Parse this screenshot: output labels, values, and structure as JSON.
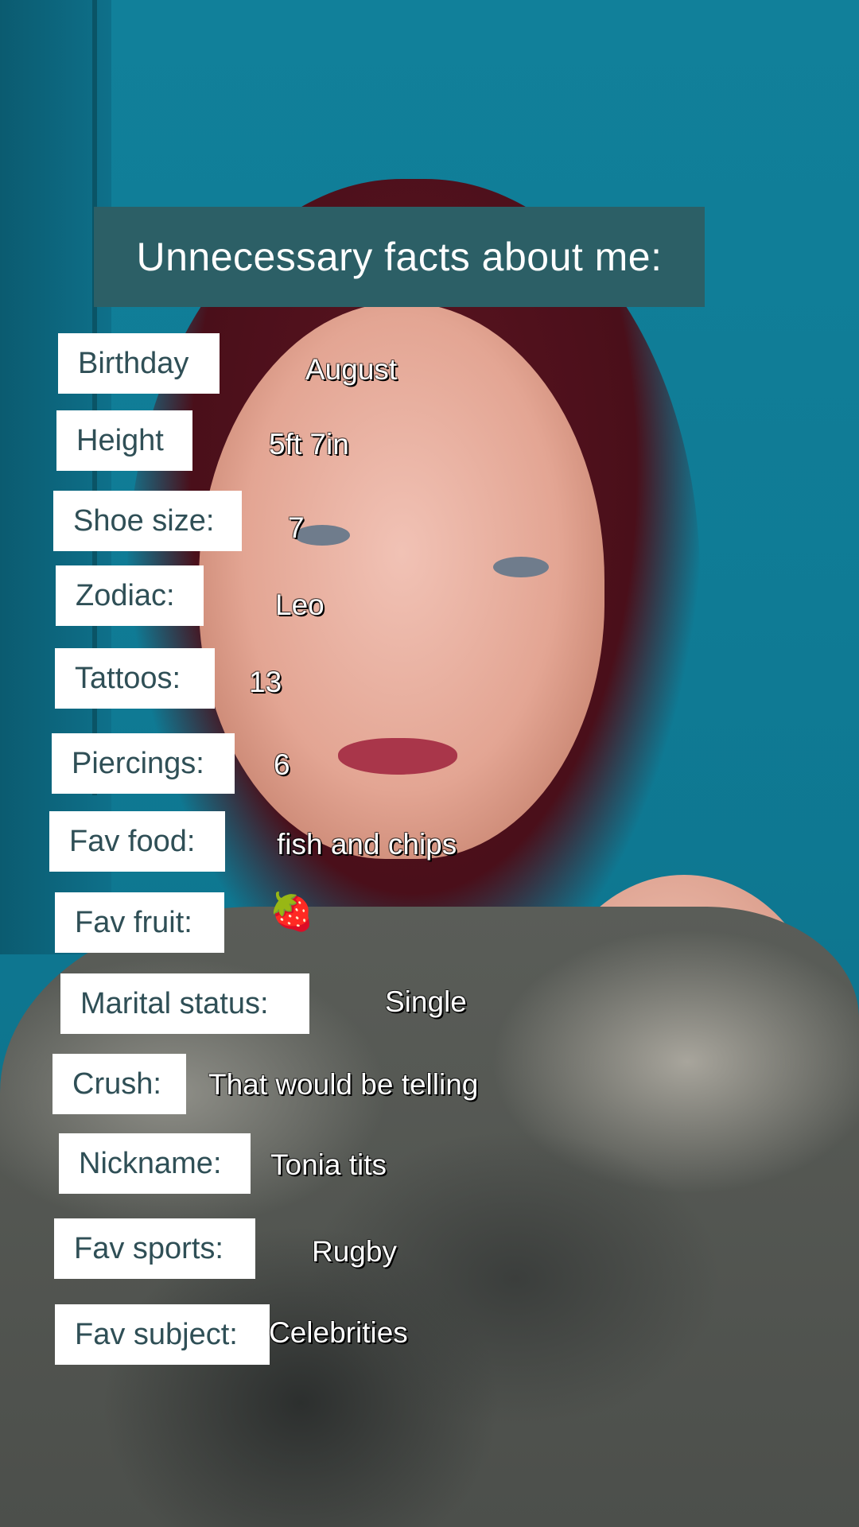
{
  "title": "Unnecessary facts about me:",
  "facts": [
    {
      "label": "Birthday",
      "value": "August"
    },
    {
      "label": "Height",
      "value": "5ft 7in"
    },
    {
      "label": "Shoe size:",
      "value": "7"
    },
    {
      "label": "Zodiac:",
      "value": "Leo"
    },
    {
      "label": "Tattoos:",
      "value": "13"
    },
    {
      "label": "Piercings:",
      "value": "6"
    },
    {
      "label": "Fav food:",
      "value": "fish and chips"
    },
    {
      "label": "Fav fruit:",
      "value": "🍓"
    },
    {
      "label": "Marital status:",
      "value": "Single"
    },
    {
      "label": "Crush:",
      "value": "That would be telling"
    },
    {
      "label": "Nickname:",
      "value": "Tonia tits"
    },
    {
      "label": "Fav sports:",
      "value": "Rugby"
    },
    {
      "label": "Fav subject:",
      "value": "Celebrities"
    }
  ],
  "colors": {
    "title_banner": "#2c5f66",
    "label_text": "#2f4f56",
    "wall": "#137f9a"
  }
}
